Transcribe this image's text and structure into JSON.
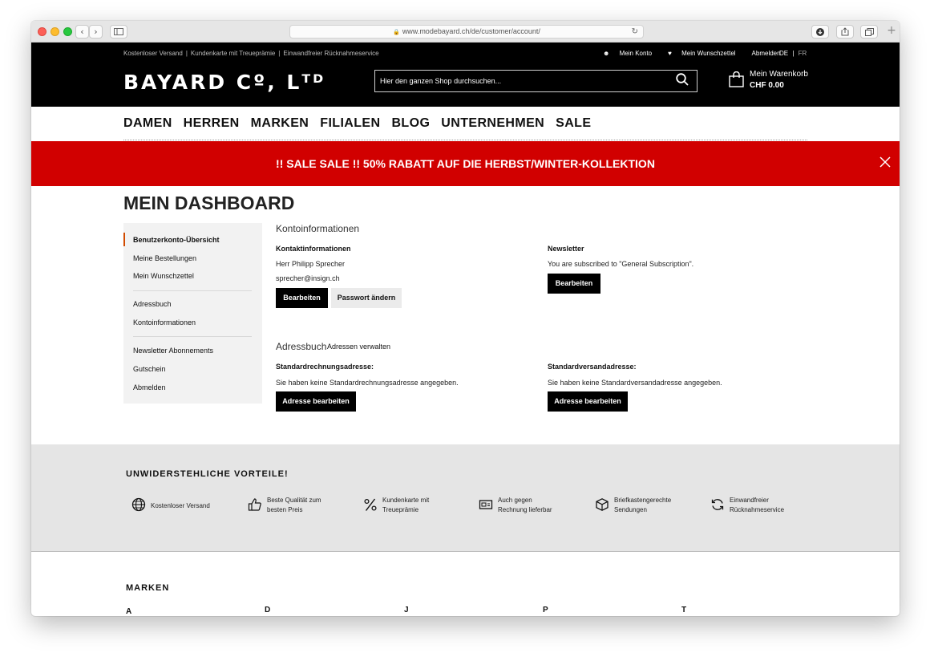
{
  "browser": {
    "url": "www.modebayard.ch/de/customer/account/"
  },
  "topbar": {
    "usps": [
      "Kostenloser Versand",
      "Kundenkarte mit Treueprämie",
      "Einwandfreier Rücknahmeservice"
    ],
    "separator": "|",
    "account": "Mein Konto",
    "wishlist": "Mein Wunschzettel",
    "logout": "Abmelden",
    "lang_de": "DE",
    "lang_sep": "|",
    "lang_fr": "FR"
  },
  "header": {
    "logo": "BAYARD Cº, Lᵀᴰ",
    "search_placeholder": "Hier den ganzen Shop durchsuchen...",
    "cart_label": "Mein Warenkorb",
    "cart_total": "CHF 0.00"
  },
  "nav": {
    "items": [
      "DAMEN",
      "HERREN",
      "MARKEN",
      "FILIALEN",
      "BLOG",
      "UNTERNEHMEN",
      "SALE"
    ]
  },
  "banner": {
    "text": "!! SALE SALE !! 50% RABATT AUF DIE HERBST/WINTER-KOLLEKTION"
  },
  "page": {
    "title": "MEIN DASHBOARD"
  },
  "sidebar": {
    "items": [
      "Benutzerkonto-Übersicht",
      "Meine Bestellungen",
      "Mein Wunschzettel",
      "Adressbuch",
      "Kontoinformationen",
      "Newsletter Abonnements",
      "Gutschein",
      "Abmelden"
    ],
    "active_index": 0
  },
  "account": {
    "section_title": "Kontoinformationen",
    "contact": {
      "label": "Kontaktinformationen",
      "name": "Herr Philipp Sprecher",
      "email": "sprecher@insign.ch",
      "edit_button": "Bearbeiten",
      "password_button": "Passwort ändern"
    },
    "newsletter": {
      "label": "Newsletter",
      "text": "You are subscribed to \"General Subscription\".",
      "edit_button": "Bearbeiten"
    }
  },
  "addressbook": {
    "section_title": "Adressbuch",
    "manage_link": "Adressen verwalten",
    "billing": {
      "label": "Standardrechnungsadresse:",
      "text": "Sie haben keine Standardrechnungsadresse angegeben.",
      "button": "Adresse bearbeiten"
    },
    "shipping": {
      "label": "Standardversandadresse:",
      "text": "Sie haben keine Standardversandadresse angegeben.",
      "button": "Adresse bearbeiten"
    }
  },
  "vorteile": {
    "title": "UNWIDERSTEHLICHE VORTEILE!",
    "items": [
      {
        "icon": "globe-icon",
        "line1": "Kostenloser Versand",
        "line2": ""
      },
      {
        "icon": "thumbs-up-icon",
        "line1": "Beste Qualität zum",
        "line2": "besten Preis"
      },
      {
        "icon": "percent-icon",
        "line1": "Kundenkarte mit",
        "line2": "Treueprämie"
      },
      {
        "icon": "invoice-icon",
        "line1": "Auch gegen",
        "line2": "Rechnung lieferbar"
      },
      {
        "icon": "box-icon",
        "line1": "Briefkastengerechte",
        "line2": "Sendungen"
      },
      {
        "icon": "refresh-icon",
        "line1": "Einwandfreier",
        "line2": "Rücknahmeservice"
      }
    ]
  },
  "marken": {
    "title": "MARKEN",
    "letters": [
      "A",
      "D",
      "J",
      "P",
      "T"
    ]
  }
}
